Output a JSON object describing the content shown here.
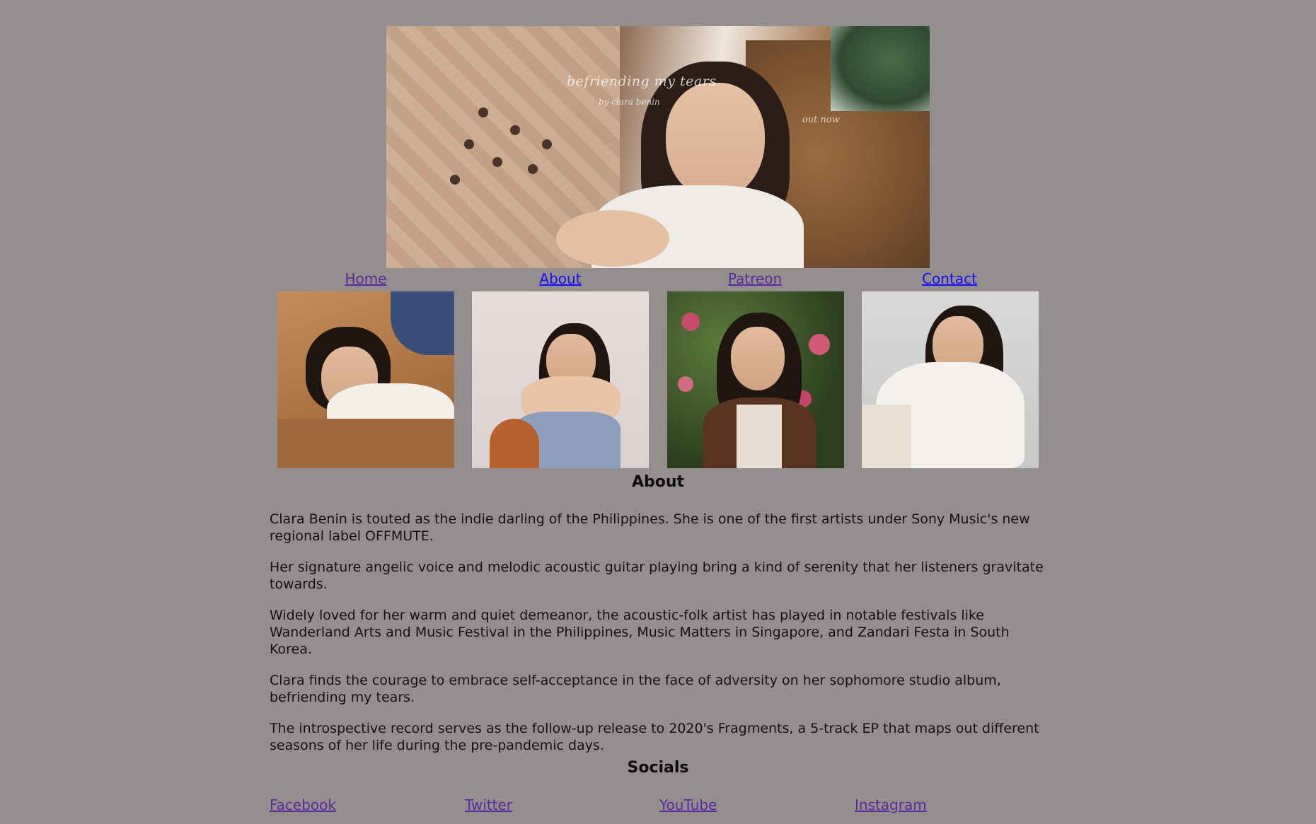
{
  "hero": {
    "album_script": "befriending my tears",
    "artist_script": "by clara benin",
    "release_script": "out now"
  },
  "nav": {
    "items": [
      {
        "label": "Home",
        "state": "visited"
      },
      {
        "label": "About",
        "state": "unvisited"
      },
      {
        "label": "Patreon",
        "state": "visited"
      },
      {
        "label": "Contact",
        "state": "unvisited"
      }
    ]
  },
  "about": {
    "heading": "About",
    "paragraphs": [
      "Clara Benin is touted as the indie darling of the Philippines. She is one of the first artists under Sony Music's new regional label OFFMUTE.",
      "Her signature angelic voice and melodic acoustic guitar playing bring a kind of serenity that her listeners gravitate towards.",
      "Widely loved for her warm and quiet demeanor, the acoustic-folk artist has played in notable festivals like Wanderland Arts and Music Festival in the Philippines, Music Matters in Singapore, and Zandari Festa in South Korea.",
      "Clara finds the courage to embrace self-acceptance in the face of adversity on her sophomore studio album, befriending my tears.",
      "The introspective record serves as the follow-up release to 2020's Fragments, a 5-track EP that maps out different seasons of her life during the pre-pandemic days."
    ]
  },
  "socials": {
    "heading": "Socials",
    "links": [
      {
        "label": "Facebook"
      },
      {
        "label": "Twitter"
      },
      {
        "label": "YouTube"
      },
      {
        "label": "Instagram"
      }
    ]
  },
  "colors": {
    "page_background": "#958e8e",
    "link_visited": "#5a2a9b",
    "link_unvisited": "#1a0dff"
  }
}
